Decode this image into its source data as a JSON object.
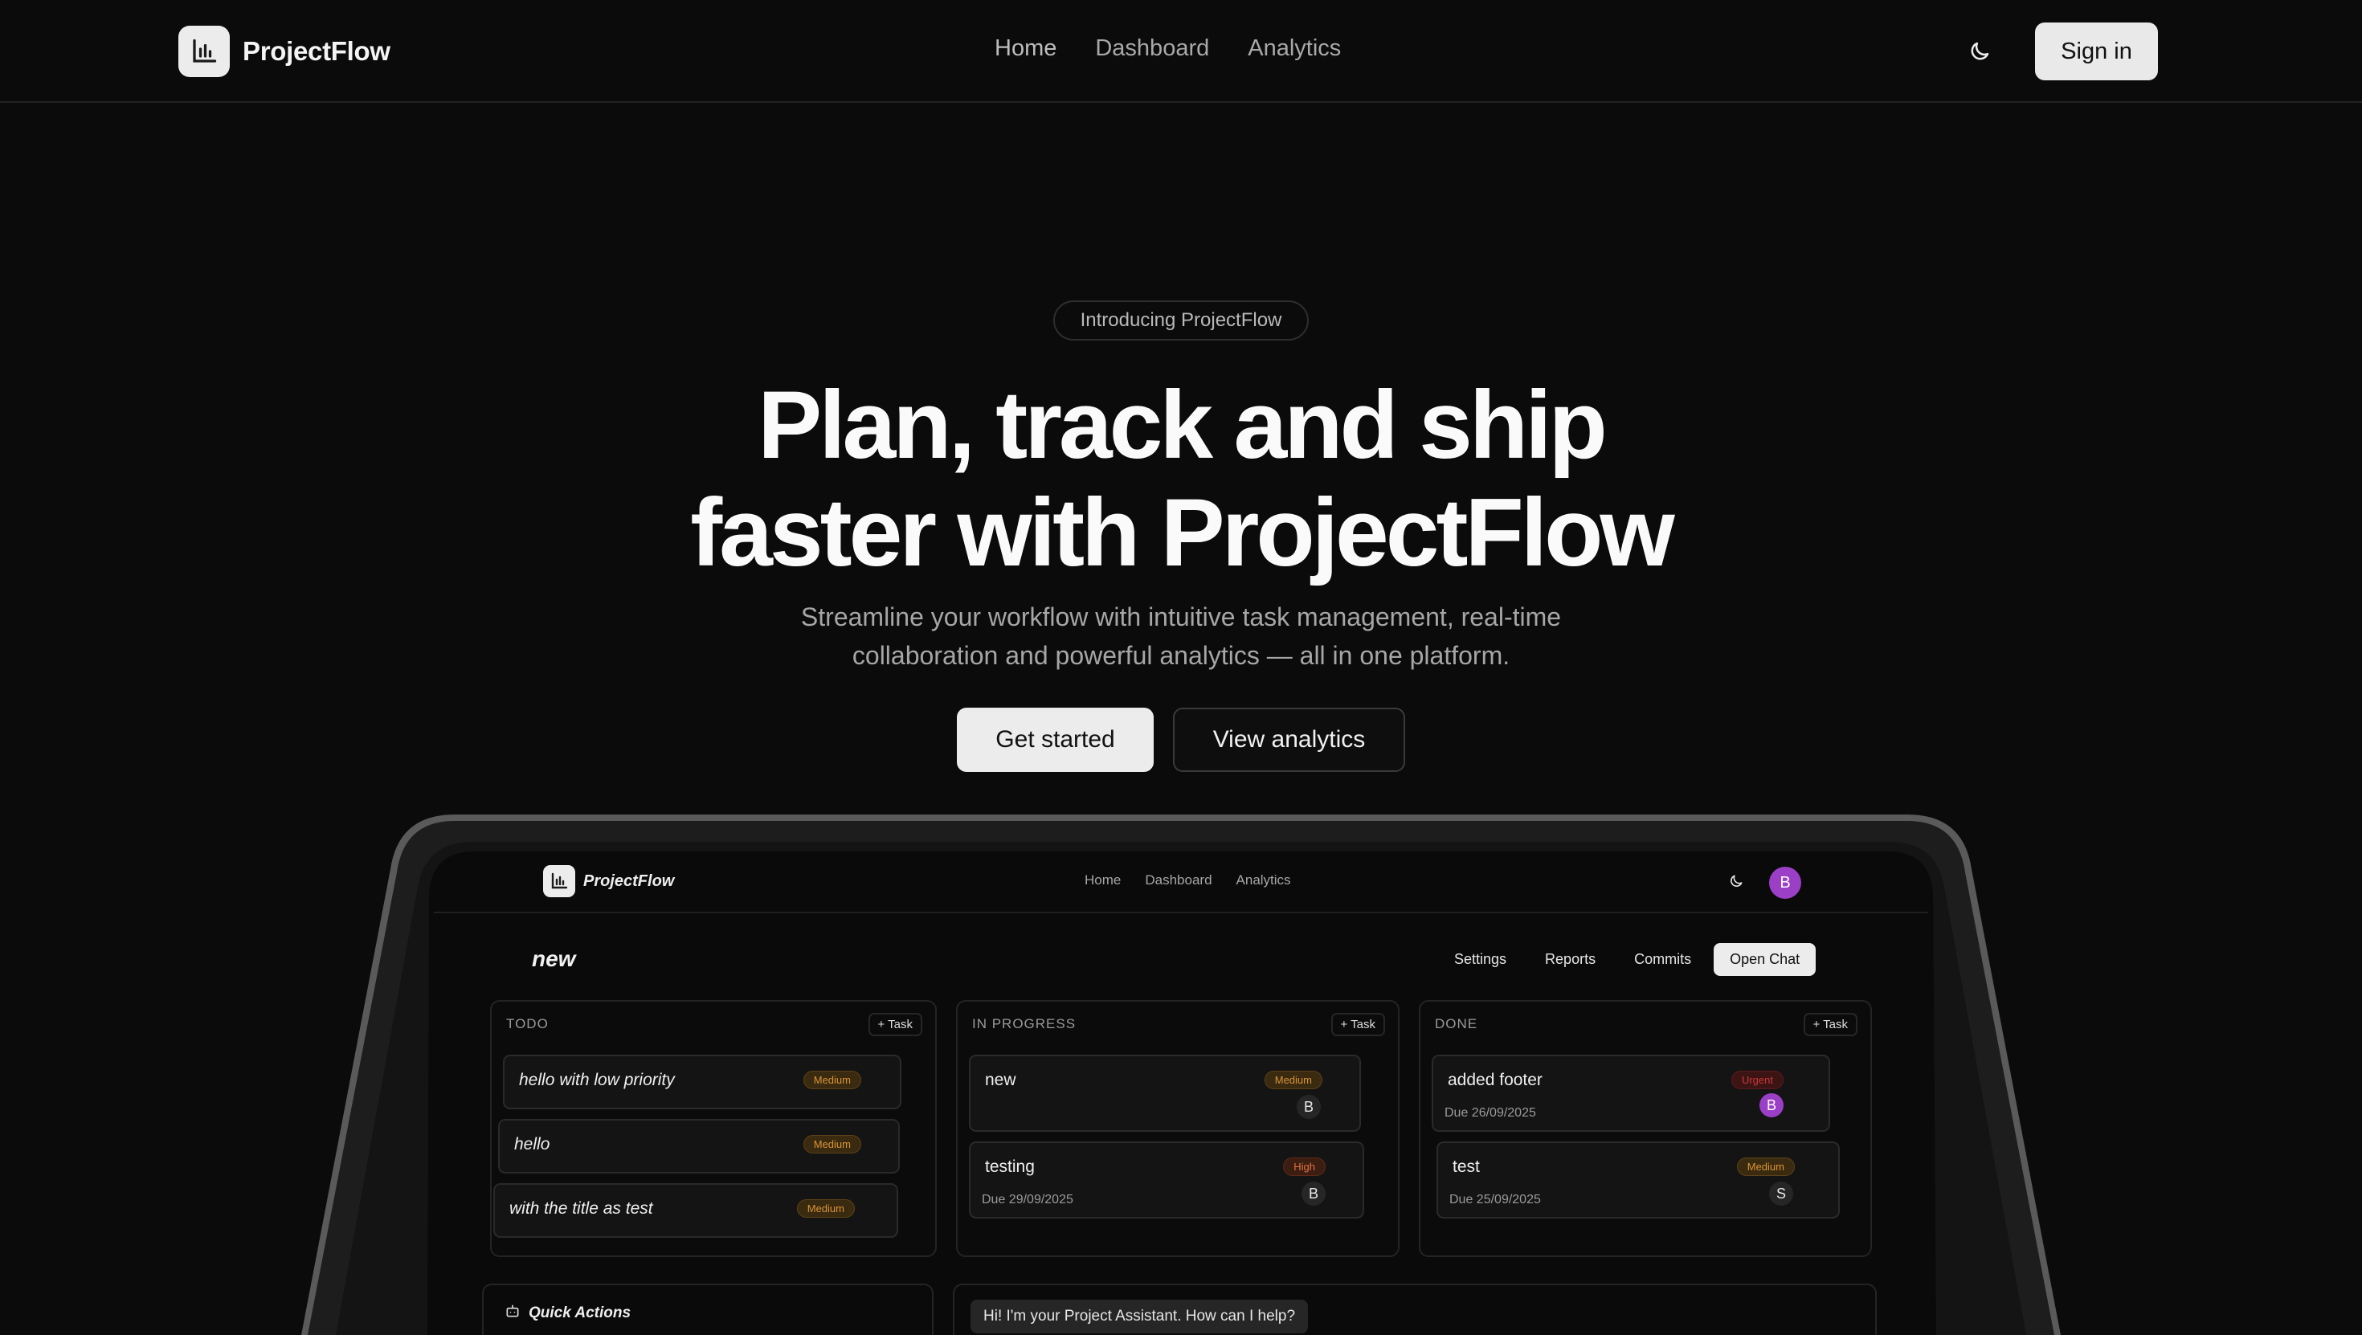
{
  "brand": {
    "name": "ProjectFlow"
  },
  "nav": {
    "home": "Home",
    "dashboard": "Dashboard",
    "analytics": "Analytics"
  },
  "auth": {
    "sign_in": "Sign in"
  },
  "hero": {
    "badge": "Introducing ProjectFlow",
    "headline_line1": "Plan, track and ship",
    "headline_line2": "faster with ProjectFlow",
    "subhead": "Streamline your workflow with intuitive task management, real-time collaboration and powerful analytics — all in one platform.",
    "cta_primary": "Get started",
    "cta_secondary": "View analytics"
  },
  "mockup": {
    "brand": "ProjectFlow",
    "nav": {
      "home": "Home",
      "dashboard": "Dashboard",
      "analytics": "Analytics"
    },
    "avatar_initial": "B",
    "project_title": "new",
    "tabs": [
      "Settings",
      "Reports",
      "Commits",
      "Open Chat"
    ],
    "add_task_label": "+ Task",
    "columns": [
      {
        "title": "TODO",
        "tasks": [
          {
            "title": "hello with low priority",
            "priority": "Medium"
          },
          {
            "title": "hello",
            "priority": "Medium"
          },
          {
            "title": "with the title as test",
            "priority": "Medium"
          }
        ]
      },
      {
        "title": "IN PROGRESS",
        "tasks": [
          {
            "title": "new",
            "priority": "Medium",
            "assignee": "B"
          },
          {
            "title": "testing",
            "priority": "High",
            "due": "Due 29/09/2025",
            "assignee": "B"
          }
        ]
      },
      {
        "title": "DONE",
        "tasks": [
          {
            "title": "added footer",
            "priority": "Urgent",
            "due": "Due 26/09/2025",
            "assignee": "B"
          },
          {
            "title": "test",
            "priority": "Medium",
            "due": "Due 25/09/2025",
            "assignee": "S"
          }
        ]
      }
    ],
    "quick_actions": "Quick Actions",
    "chat_greeting": "Hi! I'm your Project Assistant. How can I help?"
  },
  "icons": {
    "logo": "bar-chart-icon",
    "theme": "moon-icon",
    "quick_actions": "bot-icon"
  },
  "colors": {
    "background": "#0b0b0b",
    "primary_button": "#ececec",
    "avatar_purple": "#9b3fc6",
    "medium": "#d99436",
    "high": "#e0733e",
    "urgent": "#c8383a"
  }
}
